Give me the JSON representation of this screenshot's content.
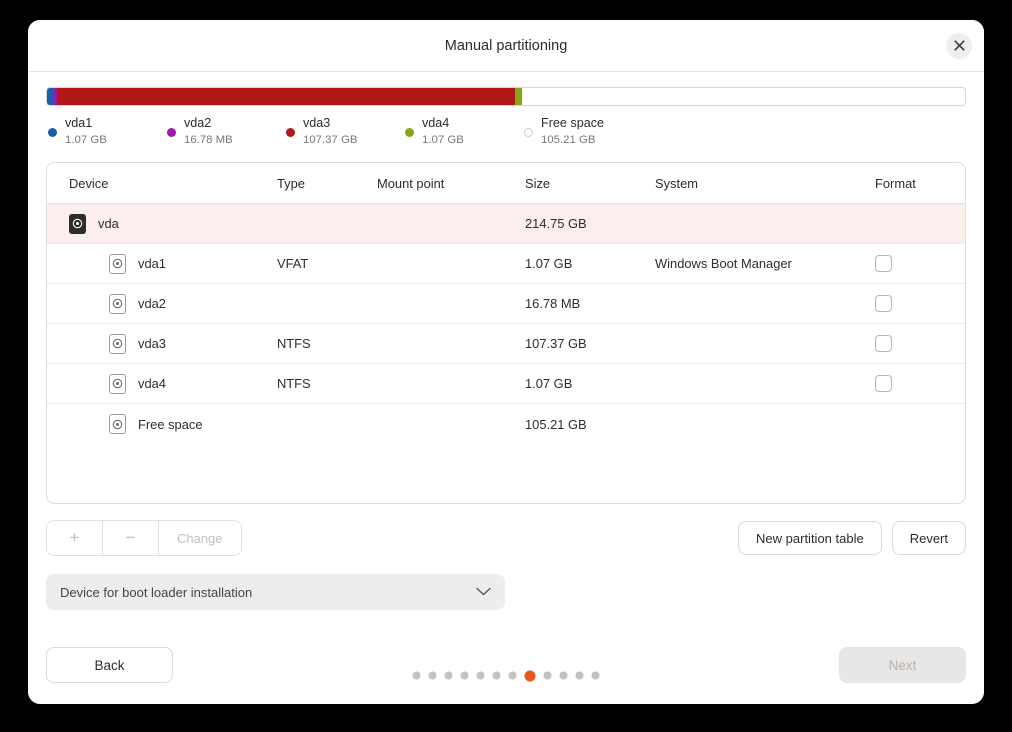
{
  "window": {
    "title": "Manual partitioning",
    "close_icon": "close-icon"
  },
  "partition_bar": {
    "total_size": "214.75 GB",
    "segments": [
      {
        "name": "vda1",
        "size": "1.07 GB",
        "color": "#1c5fa8",
        "pct": 0.8
      },
      {
        "name": "vda2",
        "size": "16.78 MB",
        "color": "#9c1aa8",
        "pct": 0.3
      },
      {
        "name": "vda3",
        "size": "107.37 GB",
        "color": "#b01717",
        "pct": 49.9
      },
      {
        "name": "vda4",
        "size": "1.07 GB",
        "color": "#84a812",
        "pct": 0.7
      },
      {
        "name": "Free space",
        "size": "105.21 GB",
        "color": "#ffffff",
        "pct": 48.3
      }
    ]
  },
  "legend": [
    {
      "name": "vda1",
      "size": "1.07 GB",
      "color": "#1c5fa8",
      "hollow": false
    },
    {
      "name": "vda2",
      "size": "16.78 MB",
      "color": "#9c1aa8",
      "hollow": false
    },
    {
      "name": "vda3",
      "size": "107.37 GB",
      "color": "#b01717",
      "hollow": false
    },
    {
      "name": "vda4",
      "size": "1.07 GB",
      "color": "#84a812",
      "hollow": false
    },
    {
      "name": "Free space",
      "size": "105.21 GB",
      "color": "#ffffff",
      "hollow": true
    }
  ],
  "table": {
    "columns": [
      "Device",
      "Type",
      "Mount point",
      "Size",
      "System",
      "Format"
    ],
    "rows": [
      {
        "device": "vda",
        "type": "",
        "mount": "",
        "size": "214.75 GB",
        "system": "",
        "format_checkbox": false,
        "selected": true,
        "child": false,
        "icon": "disk-icon"
      },
      {
        "device": "vda1",
        "type": "VFAT",
        "mount": "",
        "size": "1.07 GB",
        "system": "Windows Boot Manager",
        "format_checkbox": true,
        "selected": false,
        "child": true,
        "icon": "partition-icon"
      },
      {
        "device": "vda2",
        "type": "",
        "mount": "",
        "size": "16.78 MB",
        "system": "",
        "format_checkbox": true,
        "selected": false,
        "child": true,
        "icon": "partition-icon"
      },
      {
        "device": "vda3",
        "type": "NTFS",
        "mount": "",
        "size": "107.37 GB",
        "system": "",
        "format_checkbox": true,
        "selected": false,
        "child": true,
        "icon": "partition-icon"
      },
      {
        "device": "vda4",
        "type": "NTFS",
        "mount": "",
        "size": "1.07 GB",
        "system": "",
        "format_checkbox": true,
        "selected": false,
        "child": true,
        "icon": "partition-icon"
      },
      {
        "device": "Free space",
        "type": "",
        "mount": "",
        "size": "105.21 GB",
        "system": "",
        "format_checkbox": false,
        "selected": false,
        "child": true,
        "icon": "partition-icon"
      }
    ]
  },
  "toolbar": {
    "add_label": "+",
    "remove_label": "−",
    "change_label": "Change",
    "new_partition_table_label": "New partition table",
    "revert_label": "Revert"
  },
  "bootloader": {
    "label": "Device for boot loader installation",
    "chevron_icon": "chevron-down-icon"
  },
  "footer": {
    "back_label": "Back",
    "next_label": "Next",
    "next_disabled": true,
    "dots_total": 12,
    "dots_active_index": 7,
    "active_dot_color": "#e8561b"
  }
}
